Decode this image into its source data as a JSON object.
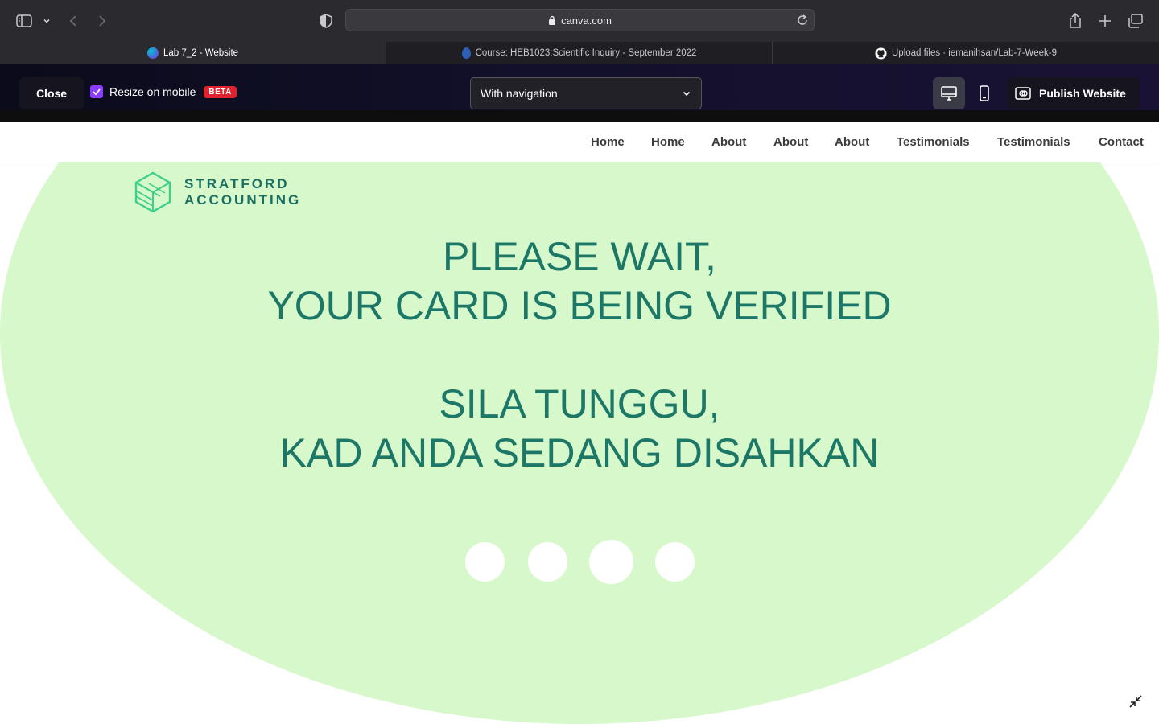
{
  "browser": {
    "url": "canva.com",
    "tabs": [
      {
        "title": "Lab 7_2 - Website",
        "active": true,
        "icon": "canva-favicon"
      },
      {
        "title": "Course: HEB1023:Scientific Inquiry - September 2022",
        "active": false,
        "icon": "course-favicon"
      },
      {
        "title": "Upload files · iemanihsan/Lab-7-Week-9",
        "active": false,
        "icon": "github-favicon"
      }
    ]
  },
  "canva": {
    "close_label": "Close",
    "resize_label": "Resize on mobile",
    "resize_checked": true,
    "beta_badge": "BETA",
    "navigation_select": "With navigation",
    "publish_label": "Publish Website",
    "accent_color": "#8b3dff"
  },
  "website": {
    "nav_links": [
      "Home",
      "Home",
      "About",
      "About",
      "About",
      "Testimonials",
      "Testimonials",
      "Contact"
    ],
    "logo_line1": "STRATFORD",
    "logo_line2": "ACCOUNTING",
    "headline_en_1": "PLEASE WAIT,",
    "headline_en_2": "YOUR CARD IS BEING VERIFIED",
    "headline_ms_1": "SILA TUNGGU,",
    "headline_ms_2": "KAD ANDA SEDANG DISAHKAN",
    "brand_color": "#1c7767",
    "background_blob_color": "#d6f8cb",
    "loading_dots": 4
  }
}
